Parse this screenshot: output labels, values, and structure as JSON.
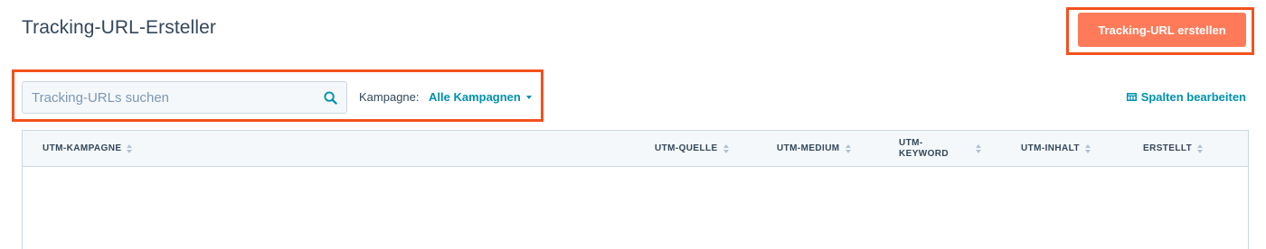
{
  "header": {
    "title": "Tracking-URL-Ersteller",
    "create_button_label": "Tracking-URL erstellen"
  },
  "filters": {
    "search_placeholder": "Tracking-URLs suchen",
    "search_value": "",
    "campaign_label": "Kampagne:",
    "campaign_value": "Alle Kampagnen"
  },
  "table_actions": {
    "edit_columns_label": "Spalten bearbeiten"
  },
  "table": {
    "columns": [
      {
        "label": "UTM-KAMPAGNE"
      },
      {
        "label": "UTM-QUELLE"
      },
      {
        "label": "UTM-MEDIUM"
      },
      {
        "label": "UTM-\nKEYWORD"
      },
      {
        "label": "UTM-INHALT"
      },
      {
        "label": "ERSTELLT"
      }
    ],
    "rows": []
  },
  "colors": {
    "primary_button": "#ff7a59",
    "link": "#0091ae",
    "highlight_outline": "#f4511e",
    "text": "#33475b"
  },
  "icons": {
    "search": "search-icon",
    "edit_columns": "columns-icon",
    "sort": "sort-icon",
    "dropdown": "caret-down-icon"
  }
}
